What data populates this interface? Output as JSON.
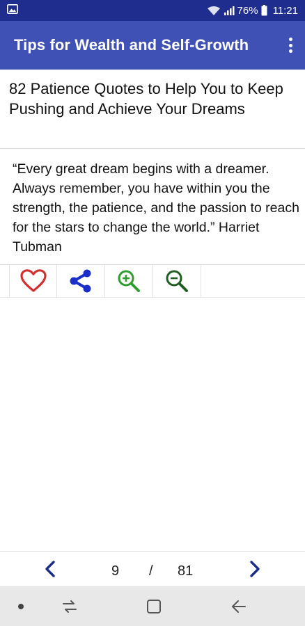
{
  "status_bar": {
    "battery_percent": "76%",
    "time": "11:21",
    "icons": [
      "image-notification-icon",
      "wifi-icon",
      "signal-icon",
      "battery-icon"
    ]
  },
  "app_bar": {
    "title": "Tips for Wealth and Self-Growth",
    "menu_icon": "more-vertical-icon"
  },
  "article": {
    "title": "82 Patience Quotes to Help You to Keep Pushing and Achieve Your Dreams"
  },
  "quote": {
    "text": "“Every great dream begins with a dreamer. Always remember, you have within you the strength, the patience, and the passion to reach for the stars to change the world.”",
    "author": "Harriet Tubman"
  },
  "actions": [
    {
      "name": "favorite",
      "icon": "heart-icon",
      "color": "#d32f2f"
    },
    {
      "name": "share",
      "icon": "share-icon",
      "color": "#1a2fc9"
    },
    {
      "name": "zoom-in",
      "icon": "zoom-in-icon",
      "color": "#2e9e2e"
    },
    {
      "name": "zoom-out",
      "icon": "zoom-out-icon",
      "color": "#1f5e1f"
    }
  ],
  "pager": {
    "current": "9",
    "separator": "/",
    "total": "81",
    "prev_icon": "chevron-left-icon",
    "next_icon": "chevron-right-icon",
    "color": "#1a2a8a"
  },
  "nav_bar": {
    "icons": [
      "dot-icon",
      "recent-apps-icon",
      "home-icon",
      "back-icon"
    ]
  },
  "colors": {
    "status_bar": "#1f2e8e",
    "app_bar": "#3f51b5",
    "nav_bar": "#e8e8e8"
  }
}
